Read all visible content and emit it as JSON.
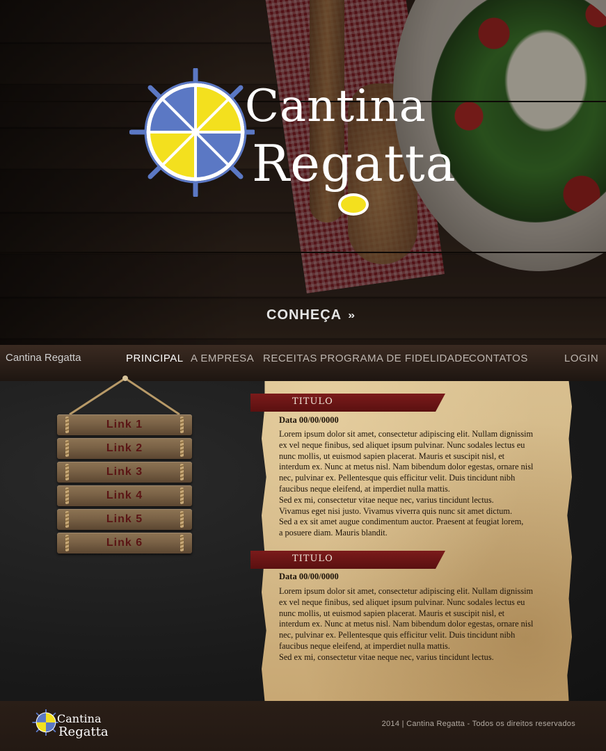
{
  "hero": {
    "logo": {
      "line1": "Cantina",
      "line2": "Regatta"
    },
    "cta": {
      "label": "CONHEÇA",
      "icon": "double-chevron-down-icon"
    }
  },
  "nav": {
    "brand": "Cantina Regatta",
    "items": [
      {
        "label": "PRINCIPAL",
        "active": true
      },
      {
        "label": "A EMPRESA"
      },
      {
        "label": "RECEITAS"
      },
      {
        "label": "PROGRAMA DE FIDELIDADE"
      },
      {
        "label": "CONTATOS"
      }
    ],
    "login": "LOGIN"
  },
  "sidebar": {
    "links": [
      "Link 1",
      "Link 2",
      "Link 3",
      "Link 4",
      "Link 5",
      "Link 6"
    ]
  },
  "articles": [
    {
      "title": "TITULO",
      "date": "Data 00/00/0000",
      "body": "Lorem ipsum dolor sit amet, consectetur adipiscing elit. Nullam dignissim\nex vel neque finibus, sed aliquet ipsum pulvinar. Nunc sodales lectus eu\nnunc mollis, ut euismod sapien placerat. Mauris et suscipit nisl, et\ninterdum ex. Nunc at metus nisl. Nam bibendum dolor egestas, ornare nisl\nnec, pulvinar ex. Pellentesque quis efficitur velit. Duis tincidunt nibh\nfaucibus neque eleifend, at imperdiet nulla mattis.\nSed ex mi, consectetur vitae neque nec, varius tincidunt lectus.\nVivamus eget nisi justo. Vivamus viverra quis nunc sit amet dictum.\nSed a ex sit amet augue condimentum auctor. Praesent at feugiat lorem,\na posuere diam. Mauris blandit."
    },
    {
      "title": "TITULO",
      "date": "Data 00/00/0000",
      "body": "Lorem ipsum dolor sit amet, consectetur adipiscing elit. Nullam dignissim\nex vel neque finibus, sed aliquet ipsum pulvinar. Nunc sodales lectus eu\nnunc mollis, ut euismod sapien placerat. Mauris et suscipit nisl, et\ninterdum ex. Nunc at metus nisl. Nam bibendum dolor egestas, ornare nisl\nnec, pulvinar ex. Pellentesque quis efficitur velit. Duis tincidunt nibh\nfaucibus neque eleifend, at imperdiet nulla mattis.\nSed ex mi, consectetur vitae neque nec, varius tincidunt lectus."
    }
  ],
  "footer": {
    "logo": {
      "line1": "Cantina",
      "line2": "Regatta"
    },
    "copyright": "2014 | Cantina Regatta - Todos os direitos reservados"
  },
  "colors": {
    "logo_blue": "#5b78c4",
    "logo_yellow": "#f3e01e",
    "ribbon": "#6e1616",
    "paper": "#d3b886",
    "link_text": "#5a1414"
  }
}
